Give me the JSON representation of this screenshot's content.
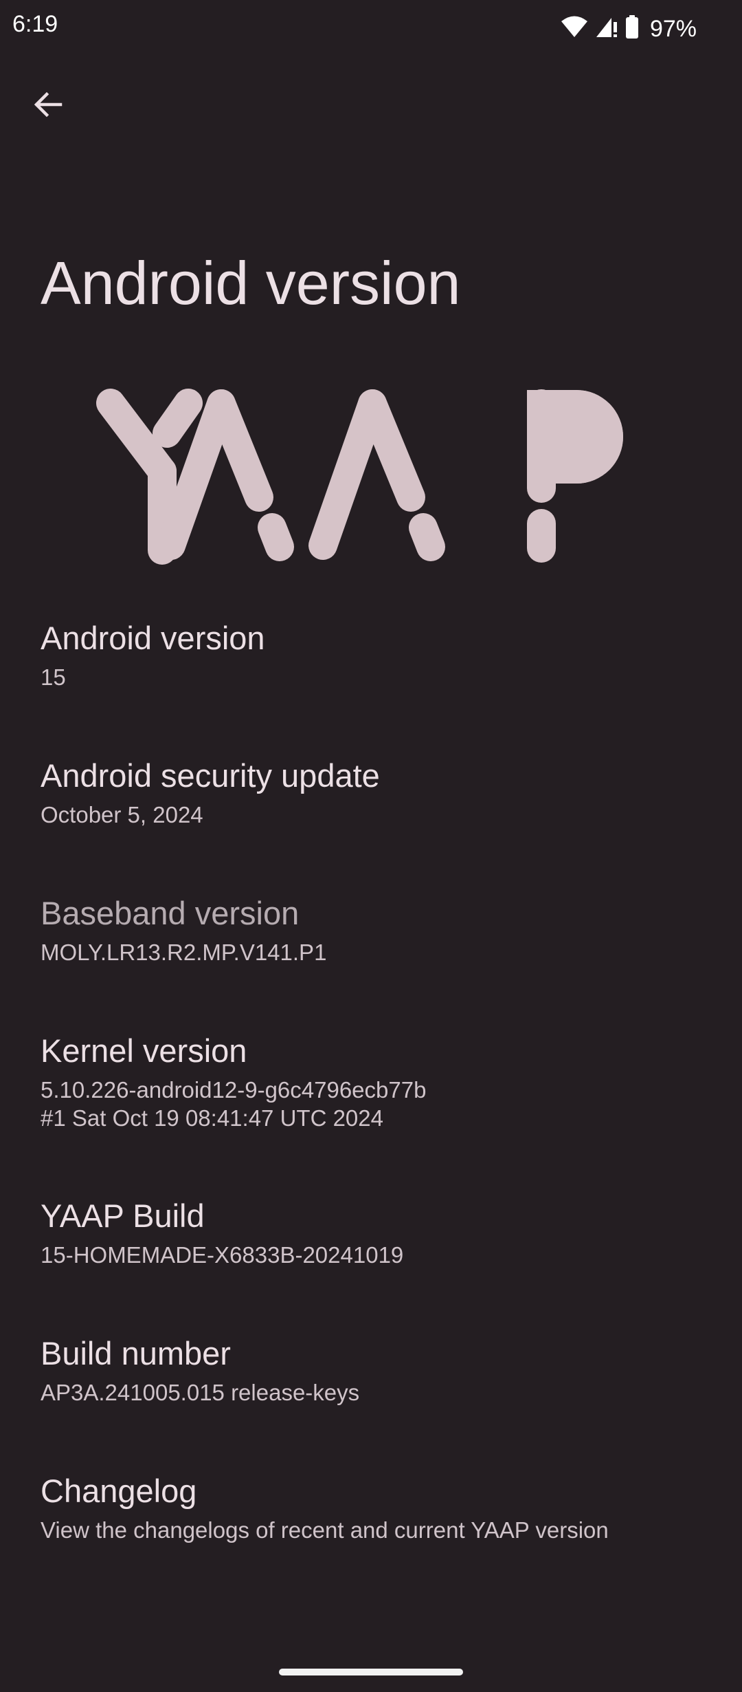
{
  "status_bar": {
    "time": "6:19",
    "battery_percent": "97%",
    "icons": [
      "wifi-icon",
      "cellular-signal-icon",
      "battery-icon"
    ]
  },
  "header": {
    "back_icon": "arrow-back-icon",
    "title": "Android version"
  },
  "logo": {
    "text": "YAAP",
    "color": "#d6c3c8"
  },
  "items": [
    {
      "title": "Android version",
      "summary": "15"
    },
    {
      "title": "Android security update",
      "summary": "October 5, 2024"
    },
    {
      "title": "Baseband version",
      "summary": "MOLY.LR13.R2.MP.V141.P1"
    },
    {
      "title": "Kernel version",
      "summary": "5.10.226-android12-9-g6c4796ecb77b\n#1 Sat Oct 19 08:41:47 UTC 2024"
    },
    {
      "title": "YAAP Build",
      "summary": "15-HOMEMADE-X6833B-20241019"
    },
    {
      "title": "Build number",
      "summary": "AP3A.241005.015 release-keys"
    },
    {
      "title": "Changelog",
      "summary": "View the changelogs of recent and current YAAP version"
    }
  ],
  "colors": {
    "background": "#241e22",
    "title_text": "#ece0e5",
    "summary_text": "#d0c4ca",
    "logo": "#d6c3c8"
  }
}
